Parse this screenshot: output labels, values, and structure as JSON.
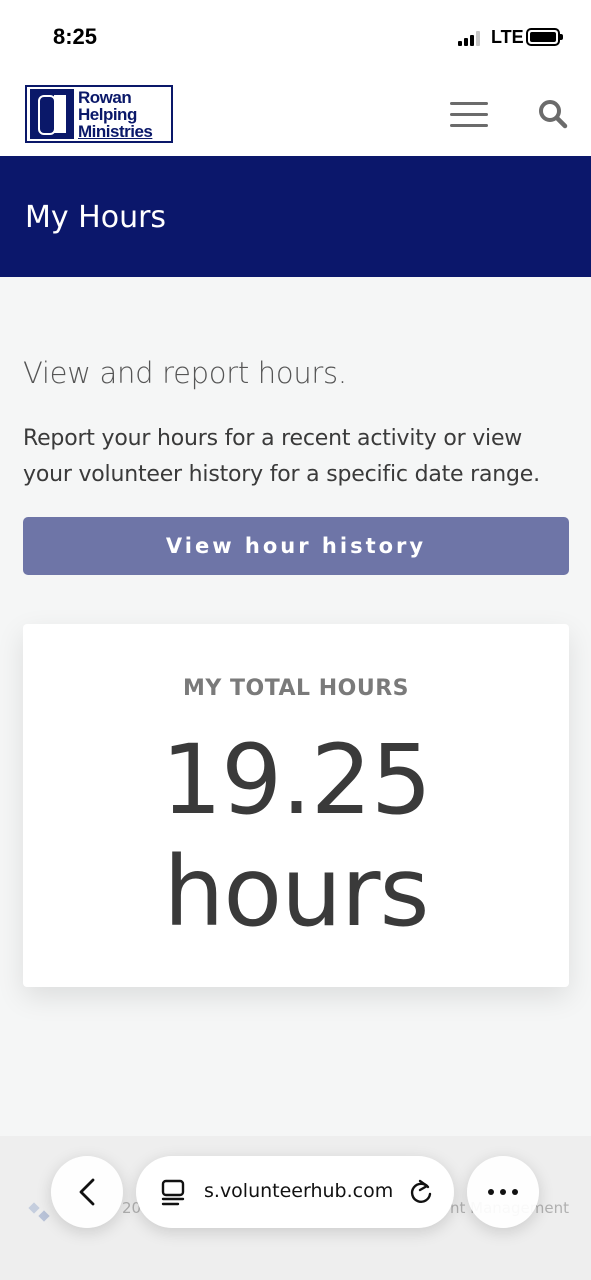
{
  "status_bar": {
    "time": "8:25",
    "network": "LTE"
  },
  "header": {
    "logo_lines": [
      "Rowan",
      "Helping",
      "Ministries"
    ]
  },
  "title_band": {
    "title": "My Hours"
  },
  "main": {
    "lead": "View and report hours.",
    "description": "Report your hours for a recent activity or view your volunteer history for a specific date range.",
    "history_button": "View hour history",
    "total_card": {
      "label": "MY TOTAL HOURS",
      "value": "19.25",
      "unit": "hours"
    }
  },
  "footer": {
    "copyright_partial": "20",
    "right_partial": "nt Management"
  },
  "browser": {
    "url": "s.volunteerhub.com"
  },
  "colors": {
    "brand_navy": "#0b176b",
    "button": "#6e75a7",
    "header_bg": "#ffffff",
    "page_bg": "#f5f6f6"
  },
  "icons": [
    "hamburger-menu-icon",
    "search-icon",
    "back-chevron-icon",
    "tabs-icon",
    "reload-icon",
    "more-dots-icon"
  ]
}
